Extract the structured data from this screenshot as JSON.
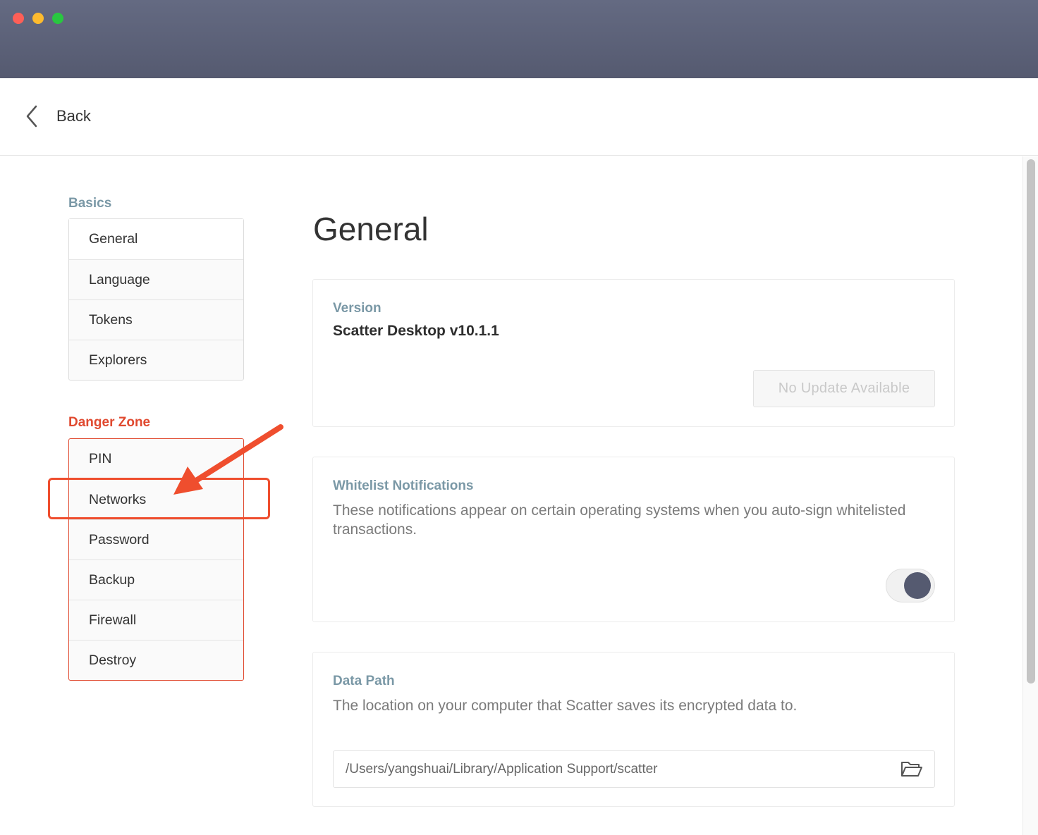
{
  "header": {
    "back_label": "Back"
  },
  "sidebar": {
    "basics_label": "Basics",
    "basics_items": [
      "General",
      "Language",
      "Tokens",
      "Explorers"
    ],
    "danger_label": "Danger Zone",
    "danger_items": [
      "PIN",
      "Networks",
      "Password",
      "Backup",
      "Firewall",
      "Destroy"
    ],
    "active_item": "General",
    "highlighted_item": "Networks"
  },
  "main": {
    "title": "General",
    "version": {
      "label": "Version",
      "value": "Scatter Desktop v10.1.1",
      "button_label": "No Update Available"
    },
    "whitelist": {
      "label": "Whitelist Notifications",
      "description": "These notifications appear on certain operating systems when you auto-sign whitelisted transactions.",
      "toggle_on": true
    },
    "data_path": {
      "label": "Data Path",
      "description": "The location on your computer that Scatter saves its encrypted data to.",
      "path": "/Users/yangshuai/Library/Application Support/scatter"
    }
  },
  "icons": {
    "back": "chevron-left-icon",
    "folder": "folder-open-icon",
    "annotation": "arrow-icon"
  },
  "colors": {
    "titlebar": "#5a5f76",
    "section_label": "#7a98a6",
    "danger": "#e0492f",
    "annotation": "#ef4e2e",
    "toggle_knob": "#555a70"
  }
}
